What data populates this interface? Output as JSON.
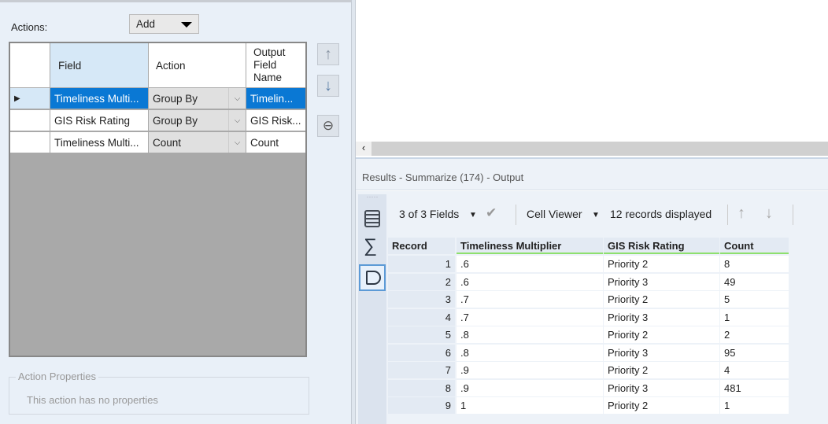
{
  "left": {
    "actions_label": "Actions:",
    "add_button": "Add",
    "columns": [
      "Field",
      "Action",
      "Output Field Name"
    ],
    "rows": [
      {
        "field": "Timeliness Multi...",
        "action": "Group By",
        "output": "Timelin...",
        "selected": true
      },
      {
        "field": "GIS Risk Rating",
        "action": "Group By",
        "output": "GIS Risk...",
        "selected": false
      },
      {
        "field": "Timeliness Multi...",
        "action": "Count",
        "output": "Count",
        "selected": false
      }
    ],
    "properties_title": "Action Properties",
    "properties_text": "This action has no properties"
  },
  "results": {
    "title": "Results - Summarize (174) - Output",
    "fields": "3 of 3 Fields",
    "viewer": "Cell Viewer",
    "records": "12 records displayed",
    "columns": [
      "Record",
      "Timeliness Multiplier",
      "GIS Risk Rating",
      "Count"
    ],
    "rows": [
      [
        "1",
        ".6",
        "Priority 2",
        "8"
      ],
      [
        "2",
        ".6",
        "Priority 3",
        "49"
      ],
      [
        "3",
        ".7",
        "Priority 2",
        "5"
      ],
      [
        "4",
        ".7",
        "Priority 3",
        "1"
      ],
      [
        "5",
        ".8",
        "Priority 2",
        "2"
      ],
      [
        "6",
        ".8",
        "Priority 3",
        "95"
      ],
      [
        "7",
        ".9",
        "Priority 2",
        "4"
      ],
      [
        "8",
        ".9",
        "Priority 3",
        "481"
      ],
      [
        "9",
        "1",
        "Priority 2",
        "1"
      ]
    ]
  }
}
